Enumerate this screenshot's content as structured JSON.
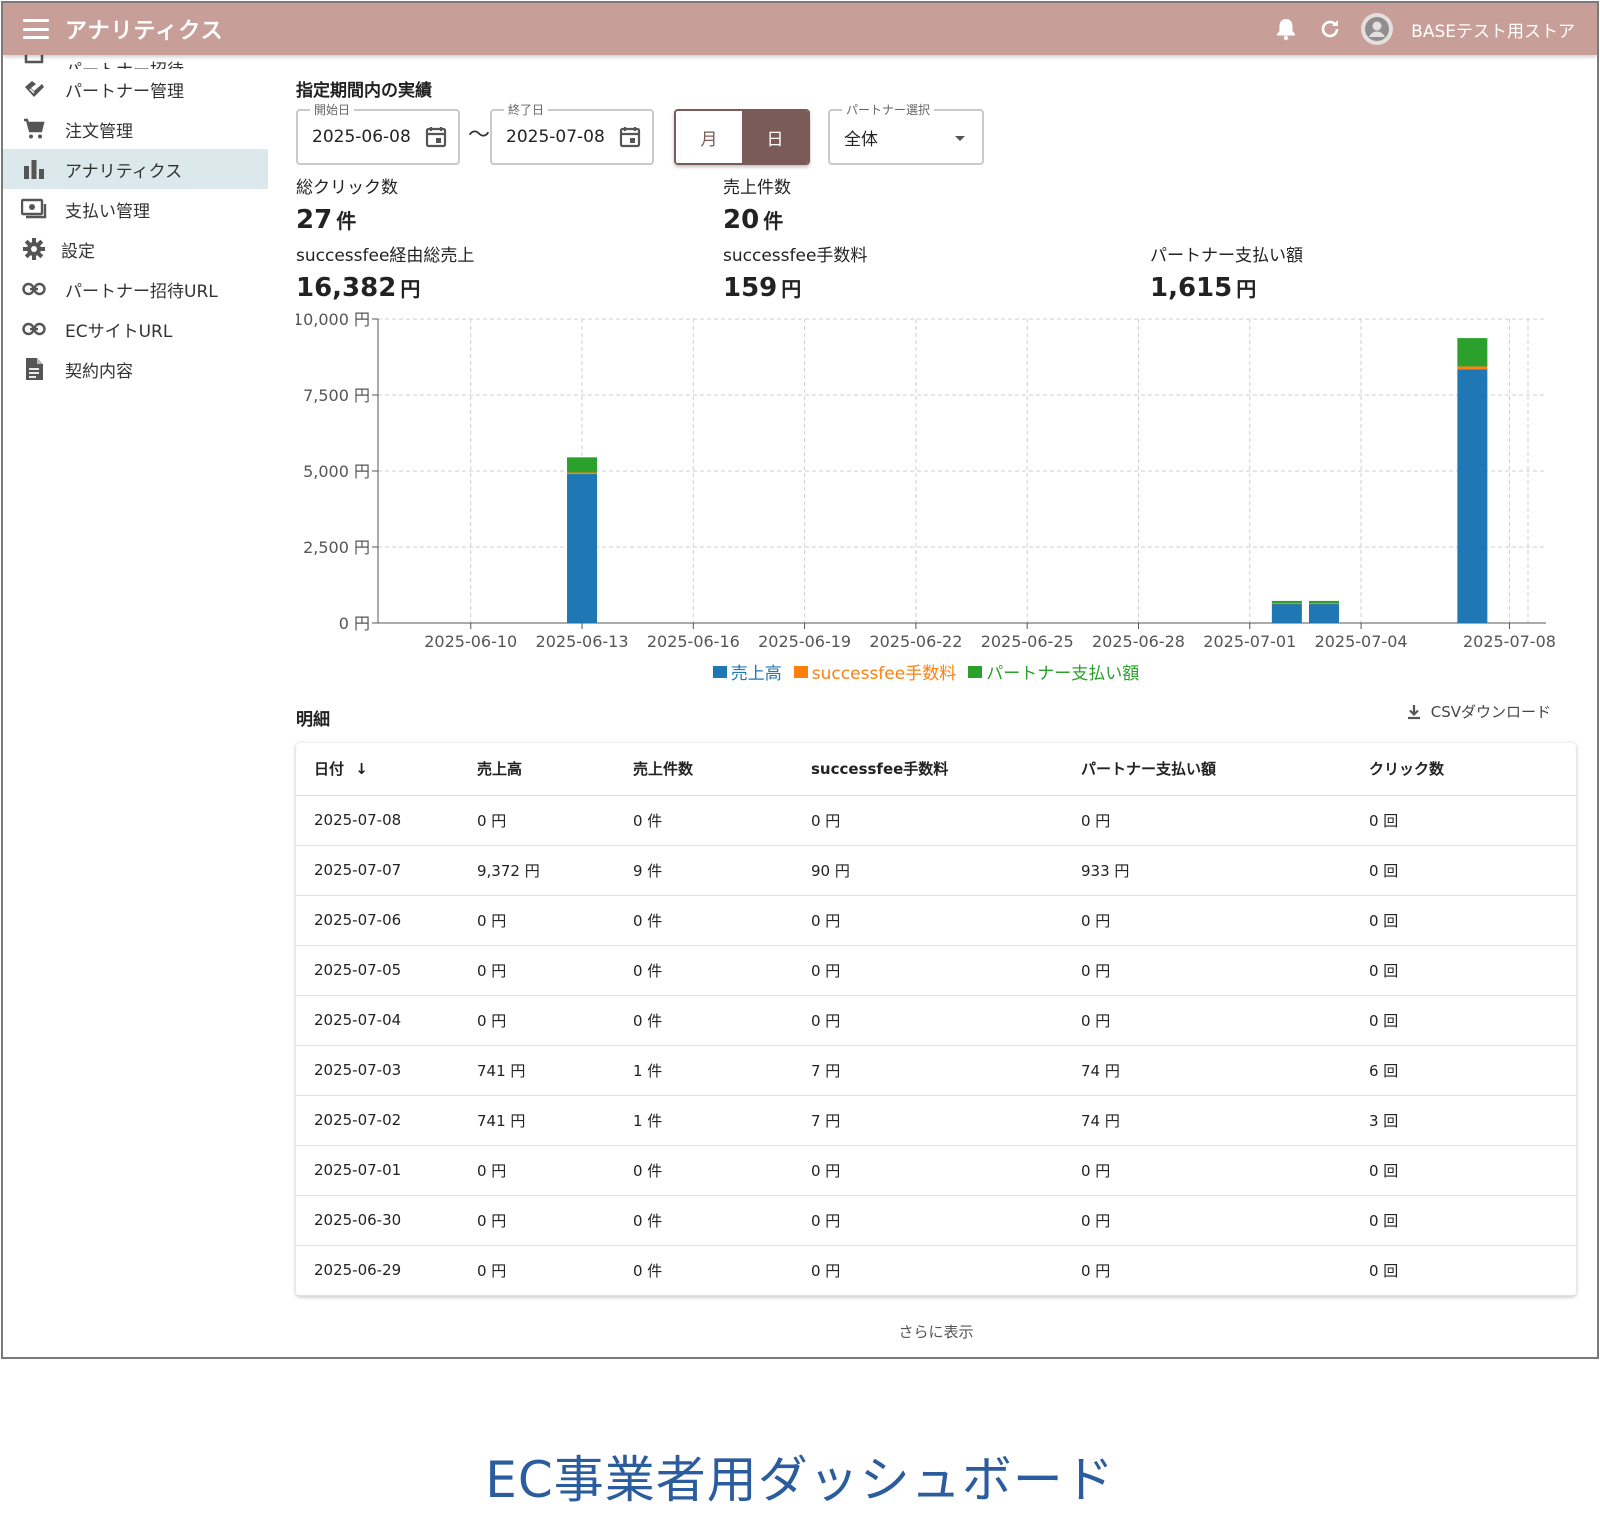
{
  "header": {
    "title": "アナリティクス",
    "store_name": "BASEテスト用ストア"
  },
  "sidebar": {
    "items": [
      {
        "label": "パートナー招待",
        "icon": "partner-invite-icon"
      },
      {
        "label": "パートナー管理",
        "icon": "handshake-icon"
      },
      {
        "label": "注文管理",
        "icon": "cart-icon"
      },
      {
        "label": "アナリティクス",
        "icon": "bar-chart-icon"
      },
      {
        "label": "支払い管理",
        "icon": "payment-icon"
      },
      {
        "label": "設定",
        "icon": "gear-icon"
      },
      {
        "label": "パートナー招待URL",
        "icon": "link-icon"
      },
      {
        "label": "ECサイトURL",
        "icon": "link-icon"
      },
      {
        "label": "契約内容",
        "icon": "document-icon"
      }
    ]
  },
  "filters": {
    "section_title": "指定期間内の実績",
    "start_label": "開始日",
    "start_value": "2025-06-08",
    "separator": "〜",
    "end_label": "終了日",
    "end_value": "2025-07-08",
    "toggle_month": "月",
    "toggle_day": "日",
    "partner_label": "パートナー選択",
    "partner_value": "全体"
  },
  "kpis": {
    "clicks_label": "総クリック数",
    "clicks_value": "27",
    "clicks_unit": "件",
    "orders_label": "売上件数",
    "orders_value": "20",
    "orders_unit": "件",
    "sales_label": "successfee経由総売上",
    "sales_value": "16,382",
    "sales_unit": "円",
    "fee_label": "successfee手数料",
    "fee_value": "159",
    "fee_unit": "円",
    "payout_label": "パートナー支払い額",
    "payout_value": "1,615",
    "payout_unit": "円"
  },
  "chart_data": {
    "type": "bar",
    "stacked": true,
    "x_ticks": [
      "2025-06-10",
      "2025-06-13",
      "2025-06-16",
      "2025-06-19",
      "2025-06-22",
      "2025-06-25",
      "2025-06-28",
      "2025-07-01",
      "2025-07-04",
      "2025-07-08"
    ],
    "y_ticks": [
      "0 円",
      "2,500 円",
      "5,000 円",
      "7,500 円",
      "10,000 円"
    ],
    "ylim": [
      0,
      10000
    ],
    "grid": true,
    "legend_position": "bottom",
    "colors": {
      "sales": "#1f77b4",
      "fee": "#ff7f0e",
      "payout": "#2ca02c"
    },
    "bars": [
      {
        "date": "2025-06-13",
        "sales": 4900,
        "fee": 50,
        "payout": 500
      },
      {
        "date": "2025-07-02",
        "sales": 646,
        "fee": 7,
        "payout": 74
      },
      {
        "date": "2025-07-03",
        "sales": 646,
        "fee": 7,
        "payout": 74
      },
      {
        "date": "2025-07-07",
        "sales": 8349,
        "fee": 90,
        "payout": 933
      }
    ],
    "series": [
      {
        "name": "売上高",
        "color": "#1f77b4"
      },
      {
        "name": "successfee手数料",
        "color": "#ff7f0e"
      },
      {
        "name": "パートナー支払い額",
        "color": "#2ca02c"
      }
    ]
  },
  "details": {
    "title": "明細",
    "csv_label": "CSVダウンロード",
    "columns": [
      "日付",
      "売上高",
      "売上件数",
      "successfee手数料",
      "パートナー支払い額",
      "クリック数"
    ],
    "rows": [
      [
        "2025-07-08",
        "0 円",
        "0 件",
        "0 円",
        "0 円",
        "0 回"
      ],
      [
        "2025-07-07",
        "9,372 円",
        "9 件",
        "90 円",
        "933 円",
        "0 回"
      ],
      [
        "2025-07-06",
        "0 円",
        "0 件",
        "0 円",
        "0 円",
        "0 回"
      ],
      [
        "2025-07-05",
        "0 円",
        "0 件",
        "0 円",
        "0 円",
        "0 回"
      ],
      [
        "2025-07-04",
        "0 円",
        "0 件",
        "0 円",
        "0 円",
        "0 回"
      ],
      [
        "2025-07-03",
        "741 円",
        "1 件",
        "7 円",
        "74 円",
        "6 回"
      ],
      [
        "2025-07-02",
        "741 円",
        "1 件",
        "7 円",
        "74 円",
        "3 回"
      ],
      [
        "2025-07-01",
        "0 円",
        "0 件",
        "0 円",
        "0 円",
        "0 回"
      ],
      [
        "2025-06-30",
        "0 円",
        "0 件",
        "0 円",
        "0 円",
        "0 回"
      ],
      [
        "2025-06-29",
        "0 円",
        "0 件",
        "0 円",
        "0 円",
        "0 回"
      ]
    ],
    "more_label": "さらに表示"
  },
  "caption": "EC事業者用ダッシュボード"
}
